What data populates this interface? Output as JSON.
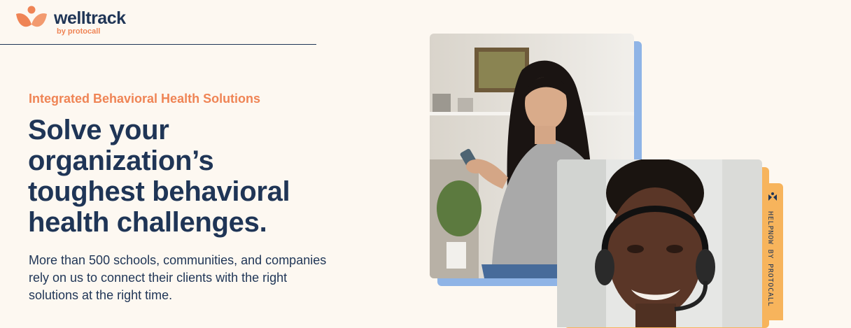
{
  "header": {
    "logo_word": "welltrack",
    "logo_sub": "by protocall"
  },
  "hero": {
    "eyebrow": "Integrated Behavioral Health Solutions",
    "headline": "Solve your organization’s toughest behavioral health challenges.",
    "description": "More than 500 schools, communities, and companies rely on us to connect their clients with the right solutions at the right time."
  },
  "media": {
    "tab_label": "HELPNOW BY PROTOCALL",
    "tab_icon": "helpnow-logo-icon"
  },
  "colors": {
    "background": "#fdf8f1",
    "navy": "#1f3556",
    "orange": "#ef8455",
    "blue_accent": "#8fb4e6",
    "gold_accent": "#f7b45c"
  }
}
